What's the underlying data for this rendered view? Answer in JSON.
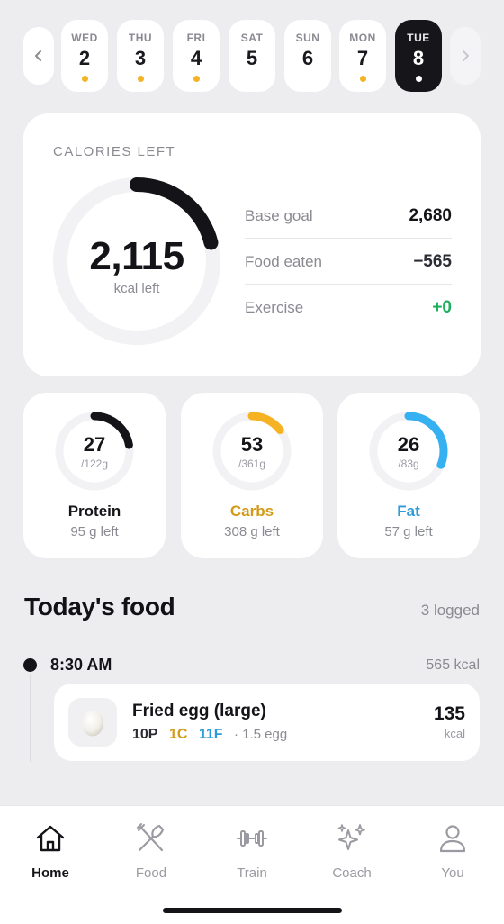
{
  "days": [
    {
      "dow": "WED",
      "num": "2",
      "logged": true
    },
    {
      "dow": "THU",
      "num": "3",
      "logged": true
    },
    {
      "dow": "FRI",
      "num": "4",
      "logged": true
    },
    {
      "dow": "SAT",
      "num": "5",
      "logged": false
    },
    {
      "dow": "SUN",
      "num": "6",
      "logged": false
    },
    {
      "dow": "MON",
      "num": "7",
      "logged": true
    },
    {
      "dow": "TUE",
      "num": "8",
      "logged": true,
      "selected": true
    }
  ],
  "calories": {
    "title": "CALORIES LEFT",
    "value": "2,115",
    "unit": "kcal left",
    "progress_fraction": 0.211,
    "rows": [
      {
        "label": "Base goal",
        "value": "2,680"
      },
      {
        "label": "Food eaten",
        "value": "−565"
      },
      {
        "label": "Exercise",
        "value": "+0"
      }
    ]
  },
  "macros": [
    {
      "name": "Protein",
      "value": "27",
      "goal": "/122g",
      "left": "95 g left",
      "progress_fraction": 0.221,
      "color": "#141418",
      "name_color": "#141418"
    },
    {
      "name": "Carbs",
      "value": "53",
      "goal": "/361g",
      "left": "308 g left",
      "progress_fraction": 0.147,
      "color": "#f5b324",
      "name_color": "#d39a1a"
    },
    {
      "name": "Fat",
      "value": "26",
      "goal": "/83g",
      "left": "57 g left",
      "progress_fraction": 0.313,
      "color": "#35b0f0",
      "name_color": "#2d9bd8"
    }
  ],
  "today": {
    "title": "Today's food",
    "count": "3 logged",
    "meal": {
      "time": "8:30 AM",
      "kcal": "565 kcal",
      "item": {
        "name": "Fried egg (large)",
        "protein": "10P",
        "carbs": "1C",
        "fat": "11F",
        "serving": "· 1.5 egg",
        "kcal": "135",
        "kcal_unit": "kcal",
        "thumbnail_icon": "egg-icon"
      }
    }
  },
  "tabs": [
    {
      "label": "Home",
      "icon": "home-icon",
      "active": true
    },
    {
      "label": "Food",
      "icon": "fork-knife-icon"
    },
    {
      "label": "Train",
      "icon": "dumbbell-icon"
    },
    {
      "label": "Coach",
      "icon": "sparkles-icon"
    },
    {
      "label": "You",
      "icon": "person-icon"
    }
  ],
  "colors": {
    "accent_dark": "#141418",
    "logged_dot": "#f5b324",
    "exercise_green": "#1fae5c",
    "background": "#ededf0"
  }
}
